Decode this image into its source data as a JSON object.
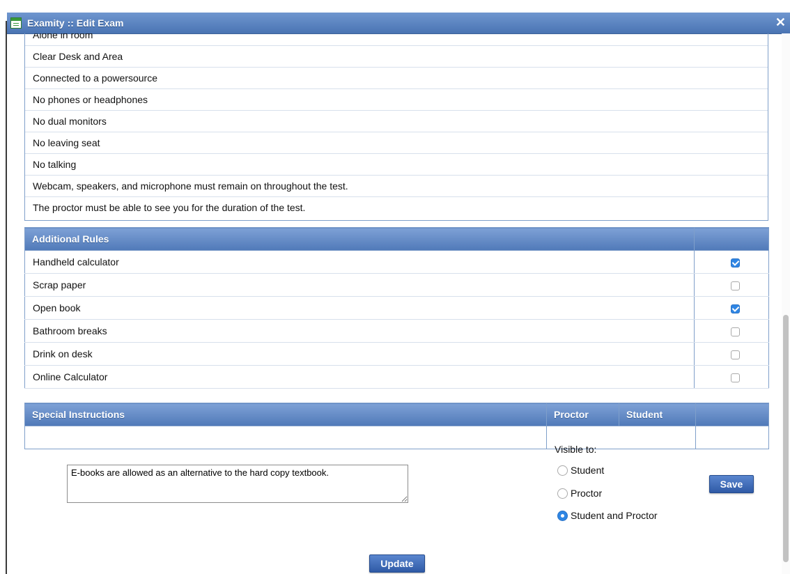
{
  "window": {
    "title": "Examity :: Edit Exam",
    "close_symbol": "✕"
  },
  "rules": [
    "Alone in room",
    "Clear Desk and Area",
    "Connected to a powersource",
    "No phones or headphones",
    "No dual monitors",
    "No leaving seat",
    "No talking",
    "Webcam, speakers, and microphone must remain on throughout the test.",
    "The proctor must be able to see you for the duration of the test."
  ],
  "additional_rules": {
    "header": "Additional Rules",
    "items": [
      {
        "label": "Handheld calculator",
        "checked": true
      },
      {
        "label": "Scrap paper",
        "checked": false
      },
      {
        "label": "Open book",
        "checked": true
      },
      {
        "label": "Bathroom breaks",
        "checked": false
      },
      {
        "label": "Drink on desk",
        "checked": false
      },
      {
        "label": "Online Calculator",
        "checked": false
      }
    ]
  },
  "special_instructions": {
    "header": "Special Instructions",
    "proctor_header": "Proctor",
    "student_header": "Student",
    "text": "E-books are allowed as an alternative to the hard copy textbook.",
    "visible_to_label": "Visible to:",
    "options": [
      {
        "label": "Student",
        "checked": false
      },
      {
        "label": "Proctor",
        "checked": false
      },
      {
        "label": "Student and Proctor",
        "checked": true
      }
    ],
    "save_label": "Save"
  },
  "update_label": "Update",
  "colors": {
    "header_blue": "#5a80bd",
    "checkbox_checked": "#2f86e4",
    "button_blue": "#3b67b3"
  }
}
